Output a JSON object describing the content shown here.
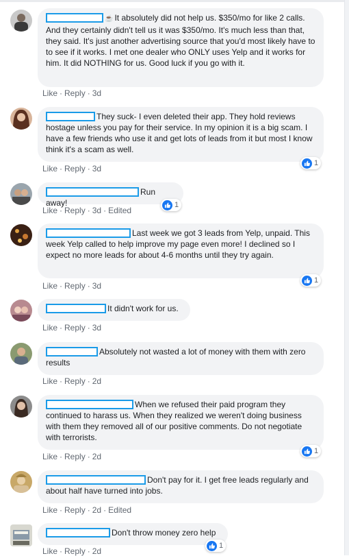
{
  "comments": [
    {
      "text": "It absolutely did not help us. $350/mo for like 2 calls. And they certainly didn't tell us it was $350/mo. It's much less than that, they said. It's just another advertising source that you'd most likely have to to see if it works. I met one dealer who ONLY uses Yelp and it works for him. It did NOTHING for us. Good luck if you go with it.",
      "emoji": "☕",
      "like": "Like",
      "reply": "Reply",
      "time": "3d",
      "edited": "",
      "reactions": ""
    },
    {
      "text": "They suck- I even deleted their app. They hold reviews hostage unless you pay for their service. In my opinion it is a big scam. I have a few friends who use it and get lots of leads from it but most I know think it's a scam as well.",
      "like": "Like",
      "reply": "Reply",
      "time": "3d",
      "edited": "",
      "reactions": "1"
    },
    {
      "text": "Run away!",
      "like": "Like",
      "reply": "Reply",
      "time": "3d",
      "edited": "Edited",
      "reactions": "1"
    },
    {
      "text": "Last week we got 3 leads from Yelp, unpaid. This week Yelp called to help improve my page even more! I declined so I expect no more leads for about 4-6 months until they try again.",
      "like": "Like",
      "reply": "Reply",
      "time": "3d",
      "edited": "",
      "reactions": "1"
    },
    {
      "text": "It didn't work for us.",
      "like": "Like",
      "reply": "Reply",
      "time": "3d",
      "edited": "",
      "reactions": ""
    },
    {
      "text": "Absolutely not wasted a lot of money with them with zero results",
      "like": "Like",
      "reply": "Reply",
      "time": "2d",
      "edited": "",
      "reactions": ""
    },
    {
      "text": "When we refused their paid program they continued to harass us. When they realized we weren't doing business with them they removed all of our positive comments. Do not negotiate with terrorists.",
      "like": "Like",
      "reply": "Reply",
      "time": "2d",
      "edited": "",
      "reactions": "1"
    },
    {
      "text": "Don't pay for it. I get free leads regularly and about half have turned into jobs.",
      "like": "Like",
      "reply": "Reply",
      "time": "2d",
      "edited": "Edited",
      "reactions": ""
    },
    {
      "text": "Don't throw money zero help",
      "like": "Like",
      "reply": "Reply",
      "time": "2d",
      "edited": "",
      "reactions": "1"
    }
  ],
  "colors": {
    "redact": "#1a9be8",
    "like_blue": "#1877f2",
    "bubble": "#f2f3f5",
    "meta": "#606770"
  },
  "icons": {
    "like": "thumbs-up-icon",
    "emoji": "coffee-icon"
  }
}
